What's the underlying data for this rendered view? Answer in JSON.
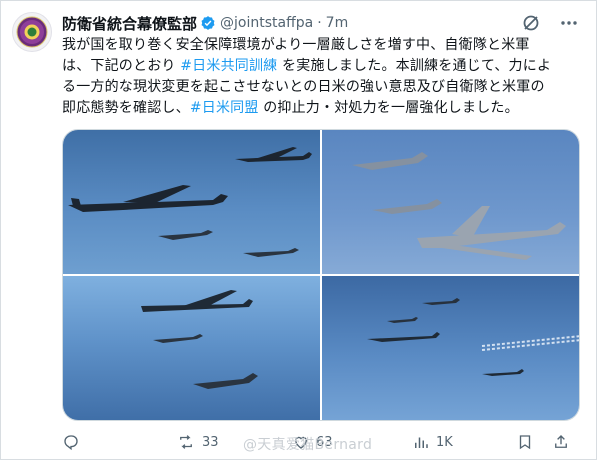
{
  "tweet": {
    "display_name": "防衛省統合幕僚監部",
    "handle": "@jointstaffpa",
    "separator": "·",
    "time": "7m",
    "text_lines": [
      {
        "parts": [
          {
            "t": "我が国を取り巻く安全保障環境がより一層厳しさを増す中、自衛隊と米軍",
            "h": false
          }
        ]
      },
      {
        "parts": [
          {
            "t": "は、下記のとおり ",
            "h": false
          },
          {
            "t": "#日米共同訓練",
            "h": true
          },
          {
            "t": " を実施しました。本訓練を通じて、力によ",
            "h": false
          }
        ]
      },
      {
        "parts": [
          {
            "t": "る一方的な現状変更を起こさせないとの日米の強い意思及び自衛隊と米軍の",
            "h": false
          }
        ]
      },
      {
        "parts": [
          {
            "t": "即応態勢を確認し、",
            "h": false
          },
          {
            "t": "#日米同盟",
            "h": true
          },
          {
            "t": " の抑止力・対処力を一層強化しました。",
            "h": false
          }
        ]
      }
    ],
    "header_icons": [
      "grok-icon",
      "more-icon"
    ],
    "media": [
      {
        "name": "photo-bomber-escort-1"
      },
      {
        "name": "photo-bomber-closeup"
      },
      {
        "name": "photo-bomber-formation"
      },
      {
        "name": "photo-distant-formation"
      }
    ],
    "actions": {
      "reply_count": "",
      "retweet_count": "33",
      "like_count": "63",
      "views_count": "1K"
    },
    "watermark": "@天真爱猫Bernard"
  },
  "colors": {
    "accent": "#1d9bf0",
    "secondary_text": "#536471",
    "primary_text": "#0f1419",
    "border": "#cfd9de"
  }
}
